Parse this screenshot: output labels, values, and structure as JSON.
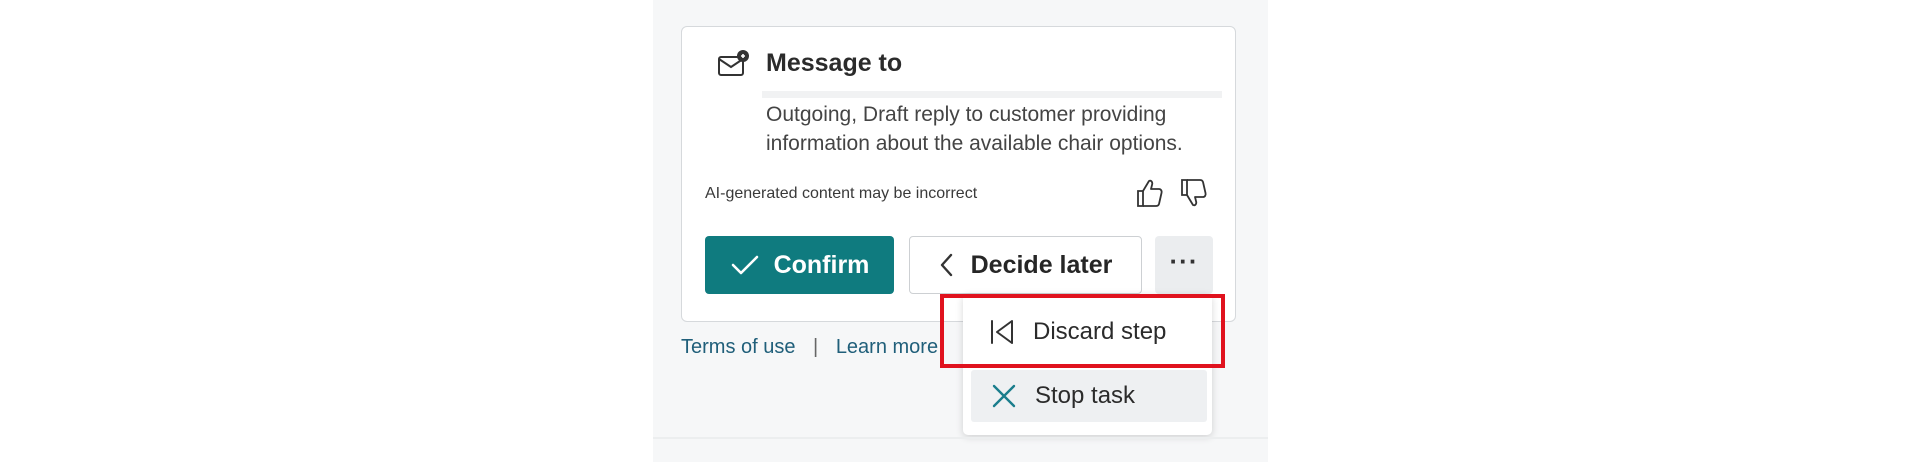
{
  "card": {
    "title": "Message to",
    "description": "Outgoing, Draft reply to customer providing information about the available chair options.",
    "ai_note": "AI-generated content may be incorrect",
    "confirm_label": "Confirm",
    "decide_later_label": "Decide later",
    "more_label": "···"
  },
  "footer": {
    "terms_label": "Terms of use",
    "separator": "|",
    "learn_more_label": "Learn more"
  },
  "menu": {
    "items": [
      {
        "label": "Discard step",
        "icon": "skip-back-icon"
      },
      {
        "label": "Stop task",
        "icon": "close-icon"
      }
    ]
  },
  "colors": {
    "accent": "#0f7b7f",
    "highlight": "#e0121e",
    "link": "#205f7a"
  }
}
